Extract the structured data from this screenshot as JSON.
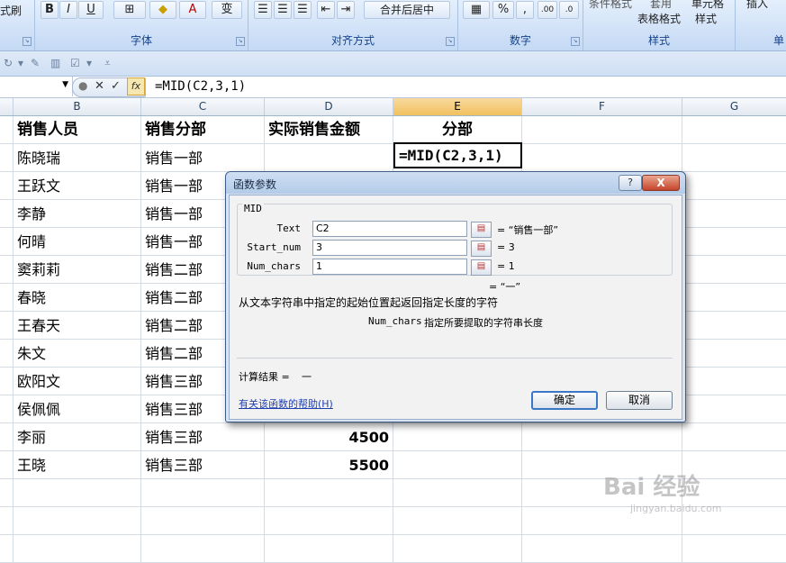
{
  "ribbon": {
    "groups": {
      "font": "字体",
      "alignment": "对齐方式",
      "number": "数字",
      "styles": "样式",
      "cells": "单"
    },
    "format_label": "式刷",
    "bold": "B",
    "italic": "I",
    "underline": "U",
    "font_color": "A",
    "phonetic": "变",
    "merge_center": "合并后居中",
    "percent": "%",
    "comma": ",",
    "inc_decimal": ".00",
    "dec_decimal": ".0",
    "table_format": "套用",
    "table_format2": "表格格式",
    "cond_format": "条件格式",
    "cell_style": "单元格",
    "cell_style2": "样式",
    "insert": "插入"
  },
  "formula_bar": {
    "formula": "=MID(C2,3,1)",
    "fx": "fx",
    "cancel": "✕",
    "enter": "✓"
  },
  "columns": [
    "B",
    "C",
    "D",
    "E",
    "F",
    "G"
  ],
  "selected_column": "E",
  "table": {
    "headers": [
      "销售人员",
      "销售分部",
      "实际销售金额",
      "分部"
    ],
    "rows": [
      {
        "name": "陈晓瑞",
        "dept": "销售一部",
        "amount": ""
      },
      {
        "name": "王跃文",
        "dept": "销售一部",
        "amount": ""
      },
      {
        "name": "李静",
        "dept": "销售一部",
        "amount": ""
      },
      {
        "name": "何晴",
        "dept": "销售一部",
        "amount": ""
      },
      {
        "name": "窦莉莉",
        "dept": "销售二部",
        "amount": ""
      },
      {
        "name": "春晓",
        "dept": "销售二部",
        "amount": ""
      },
      {
        "name": "王春天",
        "dept": "销售二部",
        "amount": ""
      },
      {
        "name": "朱文",
        "dept": "销售二部",
        "amount": ""
      },
      {
        "name": "欧阳文",
        "dept": "销售三部",
        "amount": ""
      },
      {
        "name": "侯佩佩",
        "dept": "销售三部",
        "amount": ""
      },
      {
        "name": "李丽",
        "dept": "销售三部",
        "amount": "4500"
      },
      {
        "name": "王晓",
        "dept": "销售三部",
        "amount": "5500"
      }
    ]
  },
  "edit_cell_value": "=MID(C2,3,1)",
  "dialog": {
    "title": "函数参数",
    "help_btn": "?",
    "close_btn": "X",
    "function_name": "MID",
    "args": [
      {
        "label": "Text",
        "value": "C2",
        "result": "= “销售一部”"
      },
      {
        "label": "Start_num",
        "value": "3",
        "result": "= 3"
      },
      {
        "label": "Num_chars",
        "value": "1",
        "result": "= 1"
      }
    ],
    "formula_result_preview": "= “一”",
    "description": "从文本字符串中指定的起始位置起返回指定长度的字符",
    "arg_help_name": "Num_chars",
    "arg_help_text": "指定所要提取的字符串长度",
    "calc_result_label": "计算结果 =",
    "calc_result_value": "一",
    "help_link": "有关该函数的帮助(H)",
    "ok": "确定",
    "cancel": "取消"
  },
  "watermark": {
    "main": "Bai 经验",
    "sub": "jingyan.baidu.com"
  }
}
